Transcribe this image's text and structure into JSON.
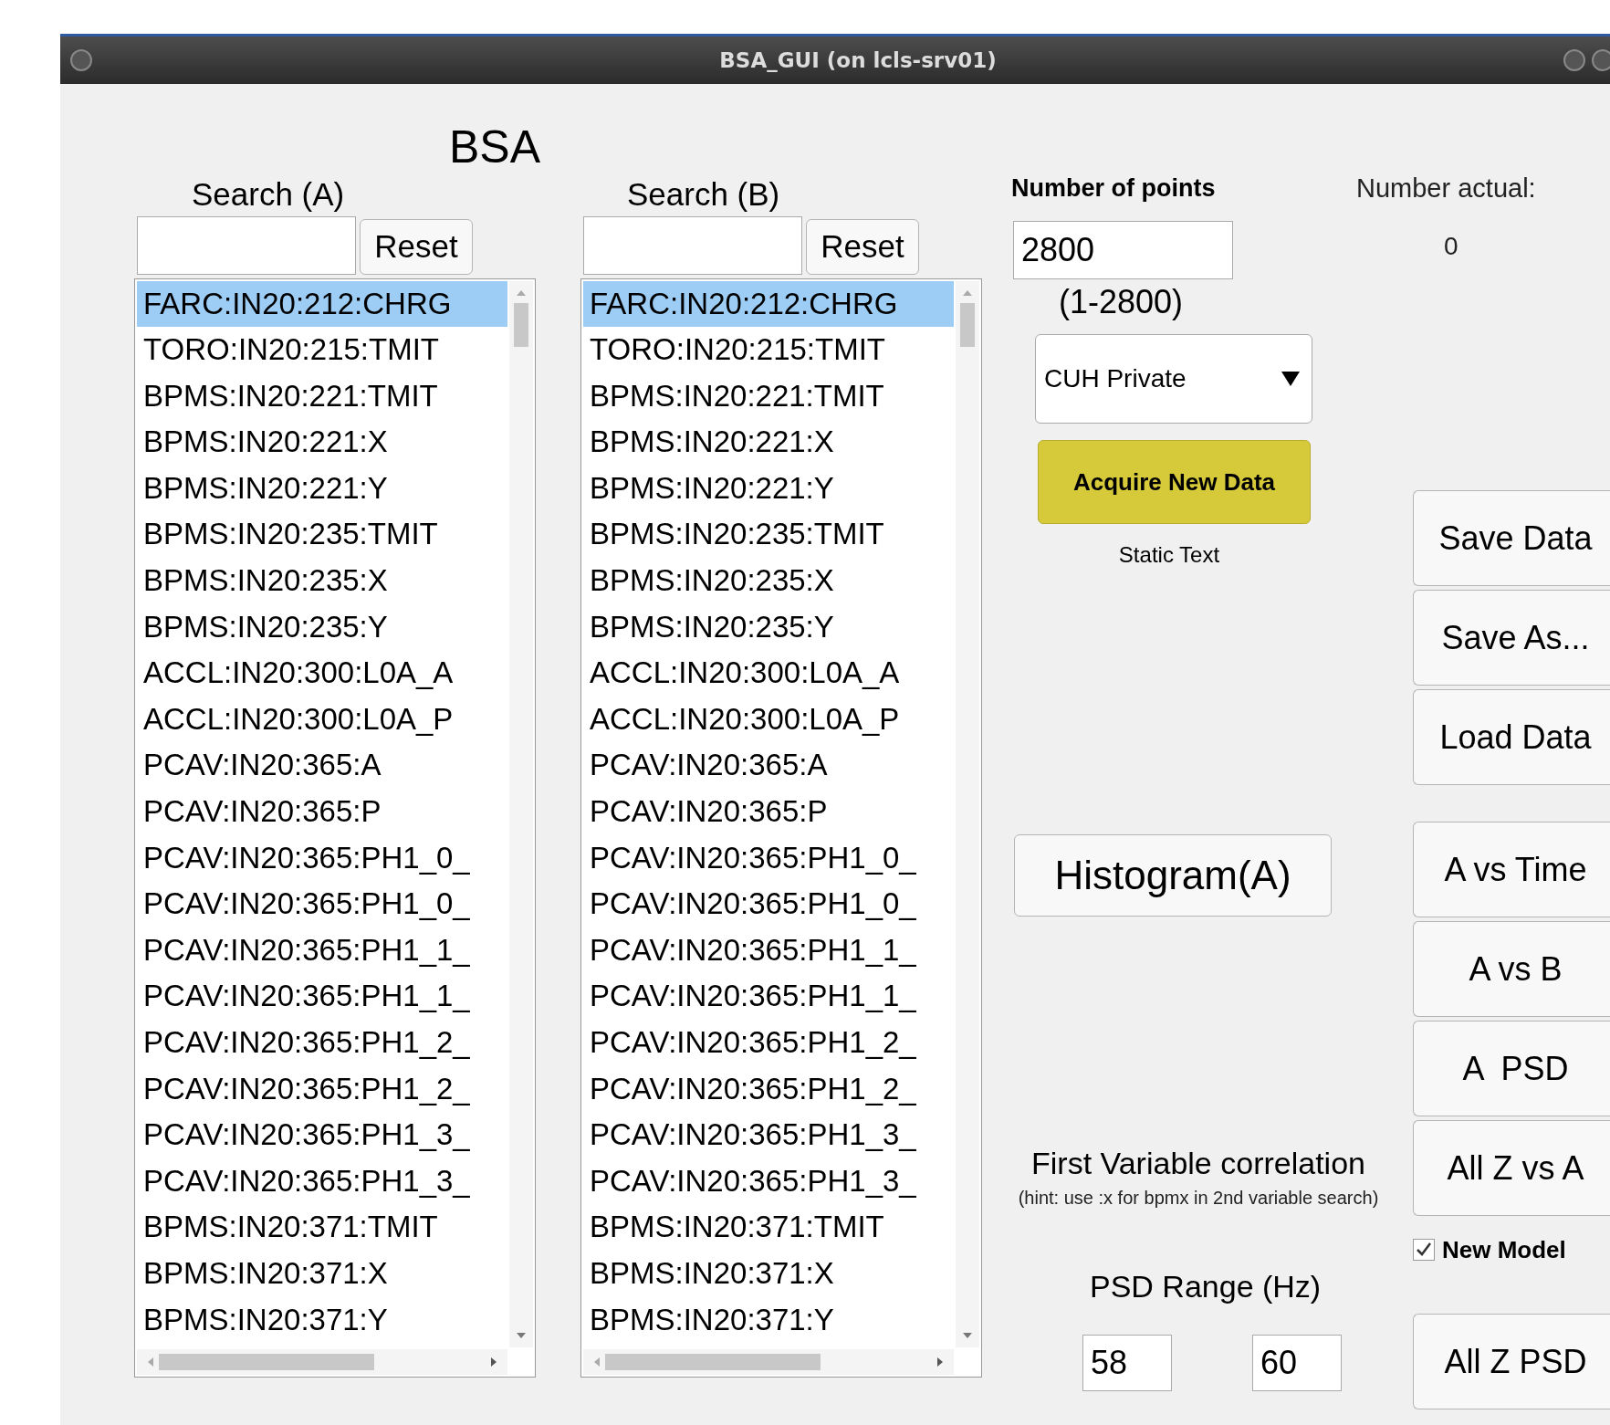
{
  "window": {
    "title": "BSA_GUI (on lcls-srv01)"
  },
  "heading": "BSA",
  "lists": [
    {
      "search_label": "Search (A)",
      "reset_button": "Reset",
      "items": [
        {
          "label": "FARC:IN20:212:CHRG",
          "selected": true
        },
        {
          "label": "TORO:IN20:215:TMIT",
          "selected": false
        },
        {
          "label": "BPMS:IN20:221:TMIT",
          "selected": false
        },
        {
          "label": "BPMS:IN20:221:X",
          "selected": false
        },
        {
          "label": "BPMS:IN20:221:Y",
          "selected": false
        },
        {
          "label": "BPMS:IN20:235:TMIT",
          "selected": false
        },
        {
          "label": "BPMS:IN20:235:X",
          "selected": false
        },
        {
          "label": "BPMS:IN20:235:Y",
          "selected": false
        },
        {
          "label": "ACCL:IN20:300:L0A_A",
          "selected": false
        },
        {
          "label": "ACCL:IN20:300:L0A_P",
          "selected": false
        },
        {
          "label": "PCAV:IN20:365:A",
          "selected": false
        },
        {
          "label": "PCAV:IN20:365:P",
          "selected": false
        },
        {
          "label": "PCAV:IN20:365:PH1_0_",
          "selected": false
        },
        {
          "label": "PCAV:IN20:365:PH1_0_",
          "selected": false
        },
        {
          "label": "PCAV:IN20:365:PH1_1_",
          "selected": false
        },
        {
          "label": "PCAV:IN20:365:PH1_1_",
          "selected": false
        },
        {
          "label": "PCAV:IN20:365:PH1_2_",
          "selected": false
        },
        {
          "label": "PCAV:IN20:365:PH1_2_",
          "selected": false
        },
        {
          "label": "PCAV:IN20:365:PH1_3_",
          "selected": false
        },
        {
          "label": "PCAV:IN20:365:PH1_3_",
          "selected": false
        },
        {
          "label": "BPMS:IN20:371:TMIT",
          "selected": false
        },
        {
          "label": "BPMS:IN20:371:X",
          "selected": false
        },
        {
          "label": "BPMS:IN20:371:Y",
          "selected": false
        }
      ]
    },
    {
      "search_label": "Search (B)",
      "reset_button": "Reset",
      "items": [
        {
          "label": "FARC:IN20:212:CHRG",
          "selected": true
        },
        {
          "label": "TORO:IN20:215:TMIT",
          "selected": false
        },
        {
          "label": "BPMS:IN20:221:TMIT",
          "selected": false
        },
        {
          "label": "BPMS:IN20:221:X",
          "selected": false
        },
        {
          "label": "BPMS:IN20:221:Y",
          "selected": false
        },
        {
          "label": "BPMS:IN20:235:TMIT",
          "selected": false
        },
        {
          "label": "BPMS:IN20:235:X",
          "selected": false
        },
        {
          "label": "BPMS:IN20:235:Y",
          "selected": false
        },
        {
          "label": "ACCL:IN20:300:L0A_A",
          "selected": false
        },
        {
          "label": "ACCL:IN20:300:L0A_P",
          "selected": false
        },
        {
          "label": "PCAV:IN20:365:A",
          "selected": false
        },
        {
          "label": "PCAV:IN20:365:P",
          "selected": false
        },
        {
          "label": "PCAV:IN20:365:PH1_0_",
          "selected": false
        },
        {
          "label": "PCAV:IN20:365:PH1_0_",
          "selected": false
        },
        {
          "label": "PCAV:IN20:365:PH1_1_",
          "selected": false
        },
        {
          "label": "PCAV:IN20:365:PH1_1_",
          "selected": false
        },
        {
          "label": "PCAV:IN20:365:PH1_2_",
          "selected": false
        },
        {
          "label": "PCAV:IN20:365:PH1_2_",
          "selected": false
        },
        {
          "label": "PCAV:IN20:365:PH1_3_",
          "selected": false
        },
        {
          "label": "PCAV:IN20:365:PH1_3_",
          "selected": false
        },
        {
          "label": "BPMS:IN20:371:TMIT",
          "selected": false
        },
        {
          "label": "BPMS:IN20:371:X",
          "selected": false
        },
        {
          "label": "BPMS:IN20:371:Y",
          "selected": false
        }
      ]
    }
  ],
  "points": {
    "label": "Number of points",
    "value": "2800",
    "range": "(1-2800)"
  },
  "number_actual": {
    "label": "Number actual:",
    "value": "0"
  },
  "dropdown": {
    "value": "CUH Private"
  },
  "acquire_button": "Acquire New Data",
  "status_text": "Static Text",
  "histogram_button": "Histogram(A)",
  "correlation": {
    "title": "First Variable correlation",
    "hint": "(hint: use :x for bpmx in 2nd variable search)"
  },
  "psd_range": {
    "label": "PSD Range (Hz)",
    "min": "58",
    "max": "60"
  },
  "side_groups": [
    {
      "items": [
        {
          "kind": "button",
          "label": "Save Data"
        },
        {
          "kind": "button",
          "label": "Save As..."
        },
        {
          "kind": "button",
          "label": "Load Data"
        }
      ]
    },
    {
      "items": [
        {
          "kind": "button",
          "label": "A vs Time"
        },
        {
          "kind": "button",
          "label": "A vs B"
        },
        {
          "kind": "button",
          "label": "A  PSD"
        },
        {
          "kind": "button",
          "label": "All Z vs A"
        },
        {
          "kind": "checkbox",
          "label": "New Model",
          "checked": true
        },
        {
          "kind": "button",
          "label": "All Z PSD"
        }
      ]
    }
  ]
}
